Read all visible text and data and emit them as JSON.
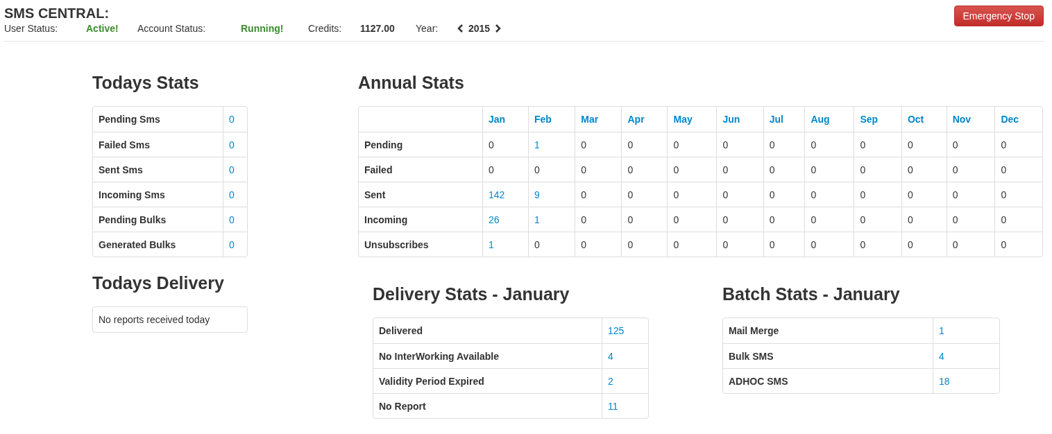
{
  "header": {
    "title": "SMS CENTRAL:",
    "fields": [
      {
        "label": "User Status:",
        "value": "Active!",
        "kind": "status"
      },
      {
        "label": "Account Status:",
        "value": "Running!",
        "kind": "status"
      },
      {
        "label": "Credits:",
        "value": "1127.00",
        "kind": "number"
      }
    ],
    "year": {
      "label": "Year:",
      "value": "2015"
    },
    "stop_button": "Emergency Stop"
  },
  "todays_stats": {
    "title": "Todays Stats",
    "rows": [
      {
        "label": "Pending Sms",
        "value": "0",
        "link": true
      },
      {
        "label": "Failed Sms",
        "value": "0",
        "link": true
      },
      {
        "label": "Sent Sms",
        "value": "0",
        "link": true
      },
      {
        "label": "Incoming Sms",
        "value": "0",
        "link": true
      },
      {
        "label": "Pending Bulks",
        "value": "0",
        "link": true
      },
      {
        "label": "Generated Bulks",
        "value": "0",
        "link": true
      }
    ]
  },
  "todays_delivery": {
    "title": "Todays Delivery",
    "message": "No reports received today"
  },
  "annual_stats": {
    "title": "Annual Stats",
    "columns": [
      "Jan",
      "Feb",
      "Mar",
      "Apr",
      "May",
      "Jun",
      "Jul",
      "Aug",
      "Sep",
      "Oct",
      "Nov",
      "Dec"
    ],
    "rows": [
      {
        "label": "Pending",
        "cells": [
          {
            "value": "0",
            "link": false
          },
          {
            "value": "1",
            "link": true
          },
          {
            "value": "0",
            "link": false
          },
          {
            "value": "0",
            "link": false
          },
          {
            "value": "0",
            "link": false
          },
          {
            "value": "0",
            "link": false
          },
          {
            "value": "0",
            "link": false
          },
          {
            "value": "0",
            "link": false
          },
          {
            "value": "0",
            "link": false
          },
          {
            "value": "0",
            "link": false
          },
          {
            "value": "0",
            "link": false
          },
          {
            "value": "0",
            "link": false
          }
        ]
      },
      {
        "label": "Failed",
        "cells": [
          {
            "value": "0",
            "link": false
          },
          {
            "value": "0",
            "link": false
          },
          {
            "value": "0",
            "link": false
          },
          {
            "value": "0",
            "link": false
          },
          {
            "value": "0",
            "link": false
          },
          {
            "value": "0",
            "link": false
          },
          {
            "value": "0",
            "link": false
          },
          {
            "value": "0",
            "link": false
          },
          {
            "value": "0",
            "link": false
          },
          {
            "value": "0",
            "link": false
          },
          {
            "value": "0",
            "link": false
          },
          {
            "value": "0",
            "link": false
          }
        ]
      },
      {
        "label": "Sent",
        "cells": [
          {
            "value": "142",
            "link": true
          },
          {
            "value": "9",
            "link": true
          },
          {
            "value": "0",
            "link": false
          },
          {
            "value": "0",
            "link": false
          },
          {
            "value": "0",
            "link": false
          },
          {
            "value": "0",
            "link": false
          },
          {
            "value": "0",
            "link": false
          },
          {
            "value": "0",
            "link": false
          },
          {
            "value": "0",
            "link": false
          },
          {
            "value": "0",
            "link": false
          },
          {
            "value": "0",
            "link": false
          },
          {
            "value": "0",
            "link": false
          }
        ]
      },
      {
        "label": "Incoming",
        "cells": [
          {
            "value": "26",
            "link": true
          },
          {
            "value": "1",
            "link": true
          },
          {
            "value": "0",
            "link": false
          },
          {
            "value": "0",
            "link": false
          },
          {
            "value": "0",
            "link": false
          },
          {
            "value": "0",
            "link": false
          },
          {
            "value": "0",
            "link": false
          },
          {
            "value": "0",
            "link": false
          },
          {
            "value": "0",
            "link": false
          },
          {
            "value": "0",
            "link": false
          },
          {
            "value": "0",
            "link": false
          },
          {
            "value": "0",
            "link": false
          }
        ]
      },
      {
        "label": "Unsubscribes",
        "cells": [
          {
            "value": "1",
            "link": true
          },
          {
            "value": "0",
            "link": false
          },
          {
            "value": "0",
            "link": false
          },
          {
            "value": "0",
            "link": false
          },
          {
            "value": "0",
            "link": false
          },
          {
            "value": "0",
            "link": false
          },
          {
            "value": "0",
            "link": false
          },
          {
            "value": "0",
            "link": false
          },
          {
            "value": "0",
            "link": false
          },
          {
            "value": "0",
            "link": false
          },
          {
            "value": "0",
            "link": false
          },
          {
            "value": "0",
            "link": false
          }
        ]
      }
    ]
  },
  "delivery_stats": {
    "title": "Delivery Stats - January",
    "rows": [
      {
        "label": "Delivered",
        "value": "125",
        "link": true
      },
      {
        "label": "No InterWorking Available",
        "value": "4",
        "link": true
      },
      {
        "label": "Validity Period Expired",
        "value": "2",
        "link": true
      },
      {
        "label": "No Report",
        "value": "11",
        "link": true
      }
    ]
  },
  "batch_stats": {
    "title": "Batch Stats - January",
    "rows": [
      {
        "label": "Mail Merge",
        "value": "1",
        "link": true
      },
      {
        "label": "Bulk SMS",
        "value": "4",
        "link": true
      },
      {
        "label": "ADHOC SMS",
        "value": "18",
        "link": true
      }
    ]
  }
}
